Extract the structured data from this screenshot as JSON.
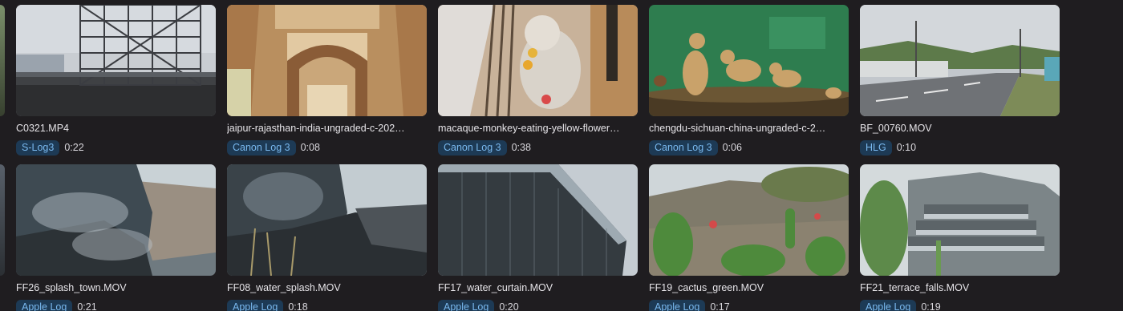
{
  "clips": [
    {
      "filename": "C0321.MP4",
      "profile": "S-Log3",
      "duration": "0:22"
    },
    {
      "filename": "jaipur-rajasthan-india-ungraded-c-202…",
      "profile": "Canon Log 3",
      "duration": "0:08"
    },
    {
      "filename": "macaque-monkey-eating-yellow-flower…",
      "profile": "Canon Log 3",
      "duration": "0:38"
    },
    {
      "filename": "chengdu-sichuan-china-ungraded-c-2…",
      "profile": "Canon Log 3",
      "duration": "0:06"
    },
    {
      "filename": "BF_00760.MOV",
      "profile": "HLG",
      "duration": "0:10"
    },
    {
      "filename": "FF26_splash_town.MOV",
      "profile": "Apple Log",
      "duration": "0:21"
    },
    {
      "filename": "FF08_water_splash.MOV",
      "profile": "Apple Log",
      "duration": "0:18"
    },
    {
      "filename": "FF17_water_curtain.MOV",
      "profile": "Apple Log",
      "duration": "0:20"
    },
    {
      "filename": "FF19_cactus_green.MOV",
      "profile": "Apple Log",
      "duration": "0:17"
    },
    {
      "filename": "FF21_terrace_falls.MOV",
      "profile": "Apple Log",
      "duration": "0:19"
    }
  ],
  "colors": {
    "background": "#1f1d20",
    "badge_bg": "#1d3a55",
    "badge_text": "#79b8ee",
    "filename_text": "#e6e4e8"
  }
}
